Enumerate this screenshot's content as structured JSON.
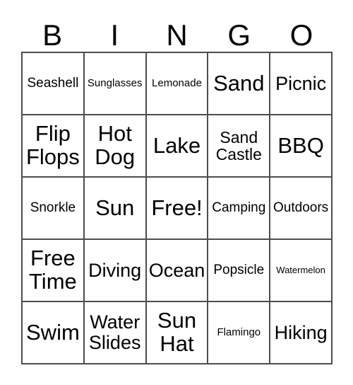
{
  "card": {
    "title": "BINGO",
    "header_letters": [
      "B",
      "I",
      "N",
      "G",
      "O"
    ],
    "border_color": "#4d4d4d",
    "background_color": "#ffffff",
    "text_color": "#000000",
    "free_space": "Free!",
    "rows": 5,
    "columns": 5,
    "cells": [
      [
        {
          "text": "Seashell",
          "size": "md"
        },
        {
          "text": "Sunglasses",
          "size": "sm"
        },
        {
          "text": "Lemonade",
          "size": "sm"
        },
        {
          "text": "Sand",
          "size": "xxl"
        },
        {
          "text": "Picnic",
          "size": "xl"
        }
      ],
      [
        {
          "text": "Flip\nFlops",
          "size": "xxl"
        },
        {
          "text": "Hot\nDog",
          "size": "xxl"
        },
        {
          "text": "Lake",
          "size": "xxl"
        },
        {
          "text": "Sand\nCastle",
          "size": "lg"
        },
        {
          "text": "BBQ",
          "size": "xxl"
        }
      ],
      [
        {
          "text": "Snorkle",
          "size": "md"
        },
        {
          "text": "Sun",
          "size": "xxl"
        },
        {
          "text": "Free!",
          "size": "xxl"
        },
        {
          "text": "Camping",
          "size": "md"
        },
        {
          "text": "Outdoors",
          "size": "md"
        }
      ],
      [
        {
          "text": "Free\nTime",
          "size": "xxl"
        },
        {
          "text": "Diving",
          "size": "xl"
        },
        {
          "text": "Ocean",
          "size": "xl"
        },
        {
          "text": "Popsicle",
          "size": "md"
        },
        {
          "text": "Watermelon",
          "size": "xs"
        }
      ],
      [
        {
          "text": "Swim",
          "size": "xxl"
        },
        {
          "text": "Water\nSlides",
          "size": "xl"
        },
        {
          "text": "Sun\nHat",
          "size": "xxl"
        },
        {
          "text": "Flamingo",
          "size": "sm"
        },
        {
          "text": "Hiking",
          "size": "xl"
        }
      ]
    ]
  }
}
